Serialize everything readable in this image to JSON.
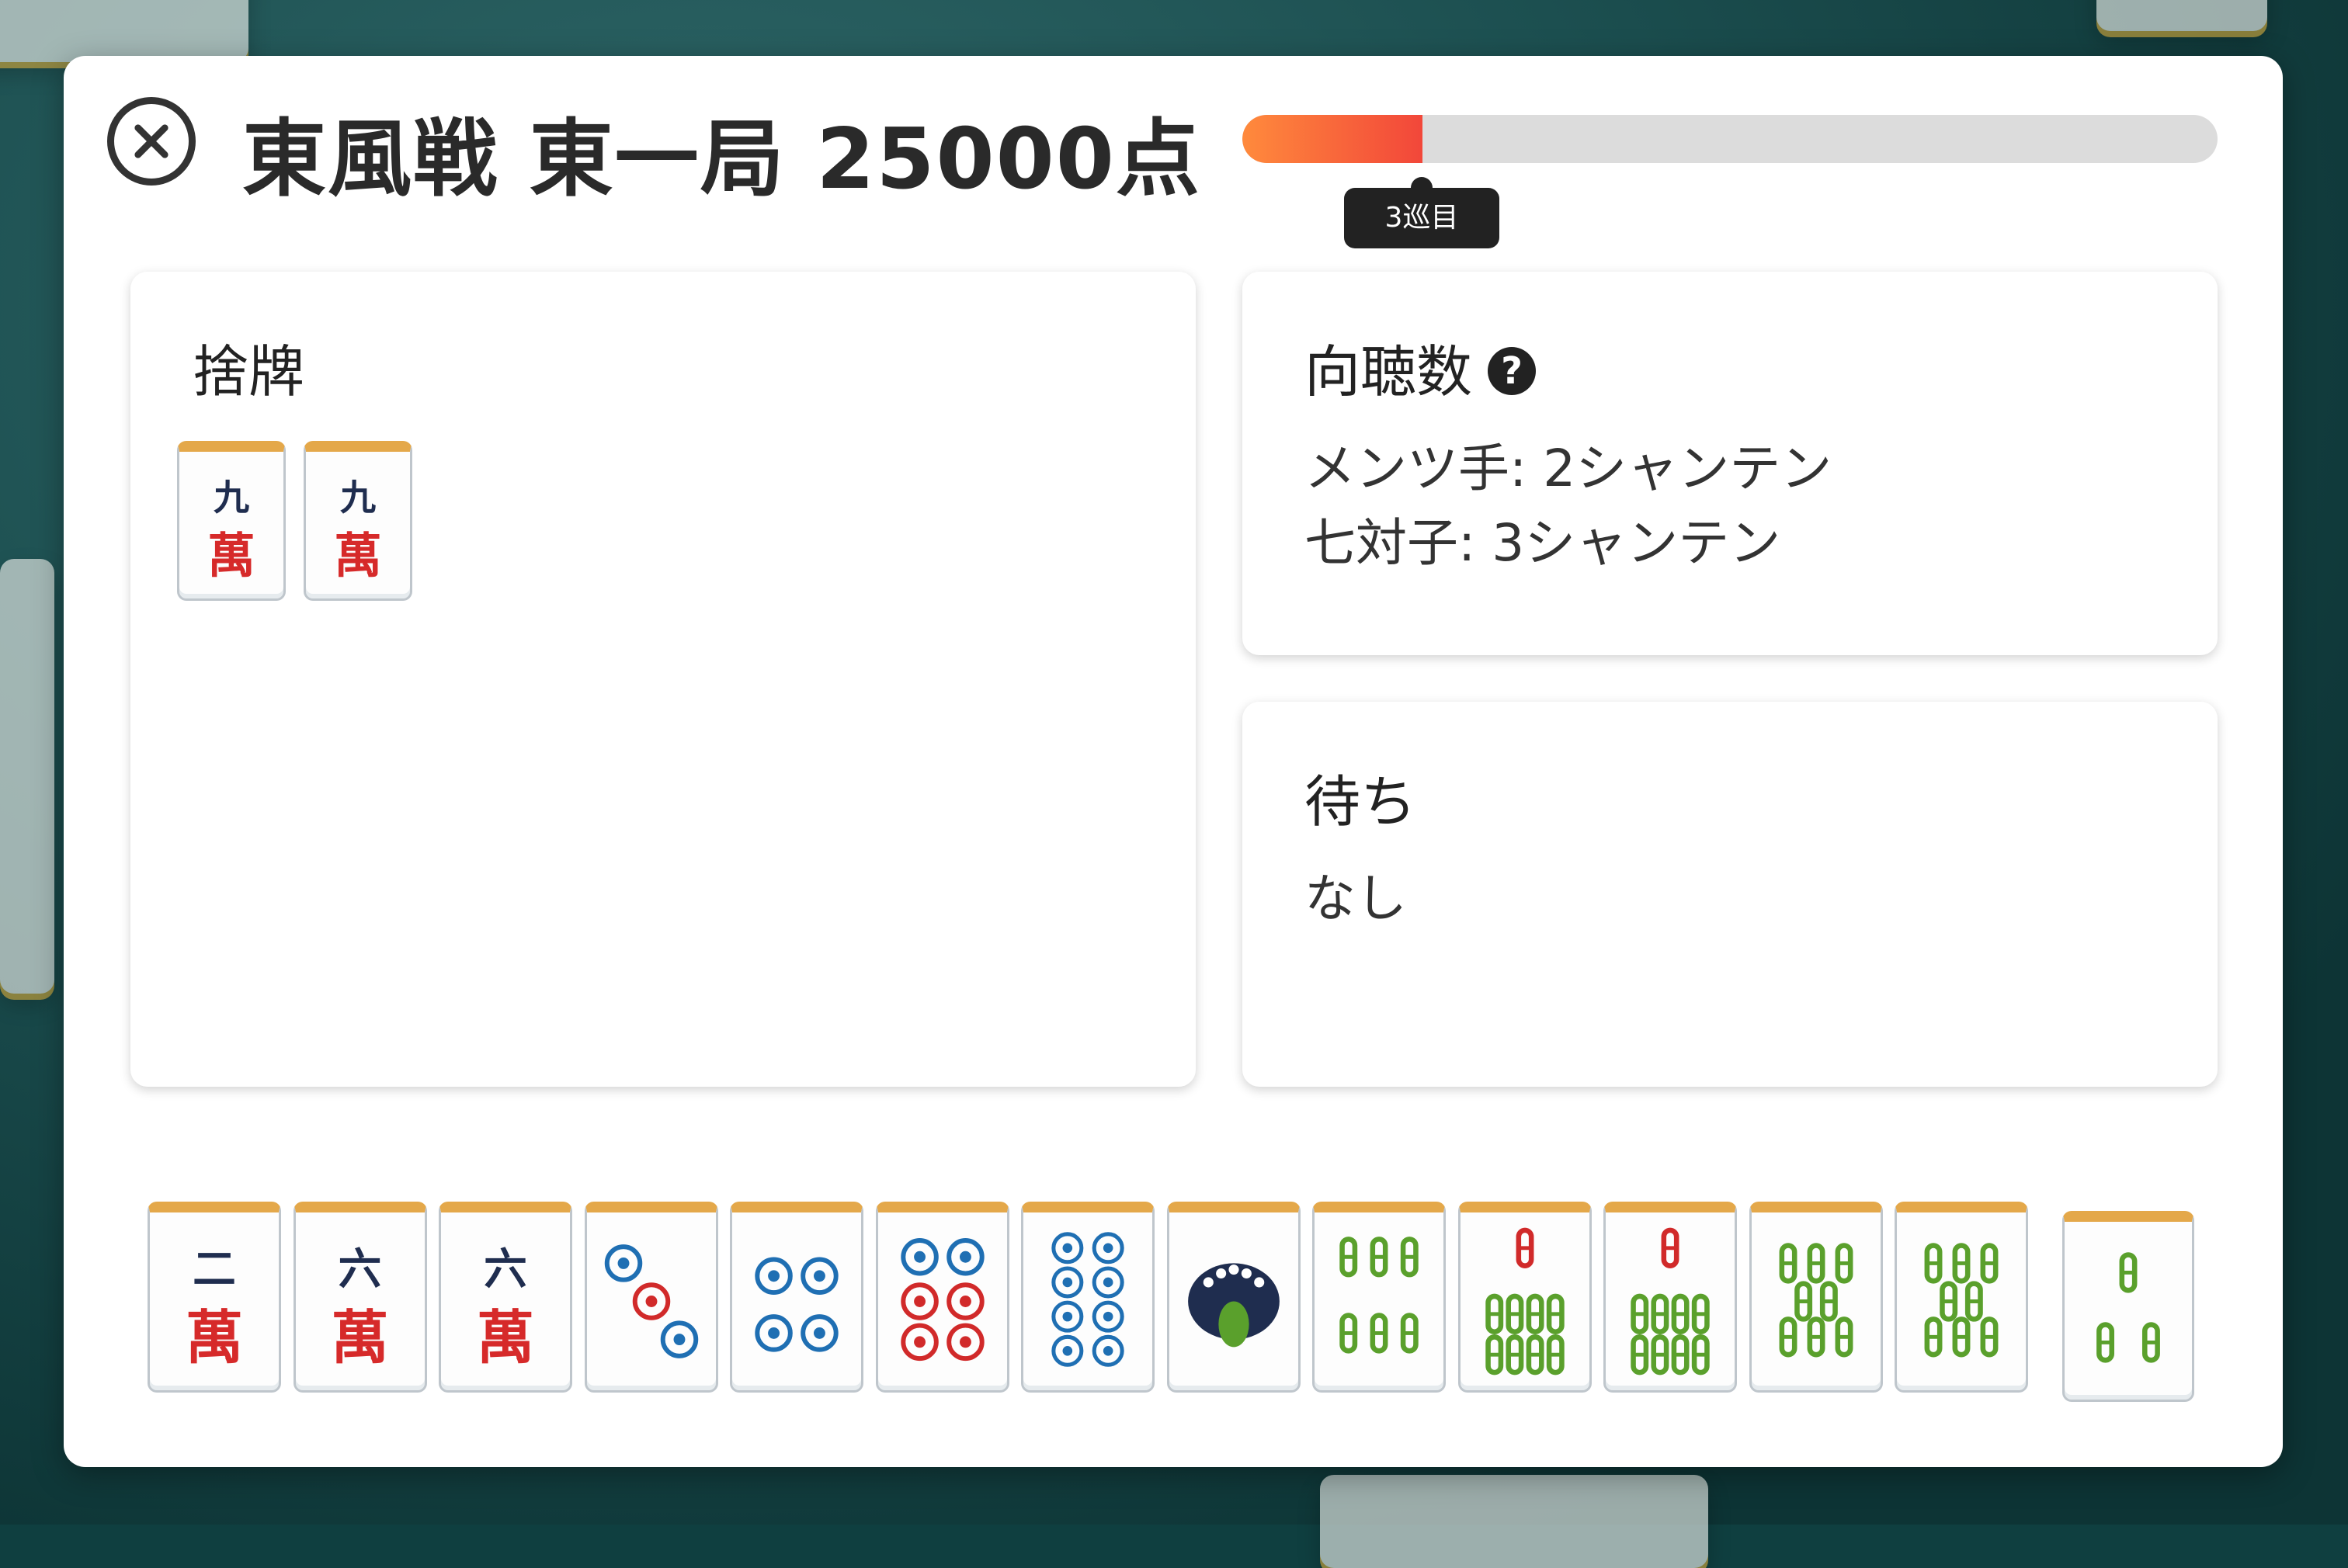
{
  "header": {
    "close_icon": "circle-x-icon",
    "title": "東風戦 東一局 25000点"
  },
  "progress": {
    "fraction": 0.185,
    "label": "3巡目",
    "colors": {
      "start": "#ff8a3c",
      "end": "#f2473a",
      "track": "#dcdcdc"
    }
  },
  "discards": {
    "title": "捨牌",
    "tiles": [
      {
        "id": "9m",
        "top": "九",
        "bottom": "萬"
      },
      {
        "id": "9m",
        "top": "九",
        "bottom": "萬"
      }
    ]
  },
  "shanten": {
    "title": "向聴数",
    "help_icon": "question-circle-icon",
    "lines": [
      "メンツ手: 2シャンテン",
      "七対子: 3シャンテン"
    ]
  },
  "waits": {
    "title": "待ち",
    "value": "なし"
  },
  "hand": {
    "tiles": [
      {
        "id": "2m",
        "top": "二",
        "bottom": "萬"
      },
      {
        "id": "6m",
        "top": "六",
        "bottom": "萬"
      },
      {
        "id": "6m",
        "top": "六",
        "bottom": "萬"
      },
      {
        "id": "3p"
      },
      {
        "id": "4p"
      },
      {
        "id": "6p"
      },
      {
        "id": "8p"
      },
      {
        "id": "1s"
      },
      {
        "id": "6s"
      },
      {
        "id": "7s"
      },
      {
        "id": "7s"
      },
      {
        "id": "8s"
      },
      {
        "id": "8s"
      }
    ],
    "drawn": {
      "id": "3s"
    }
  }
}
